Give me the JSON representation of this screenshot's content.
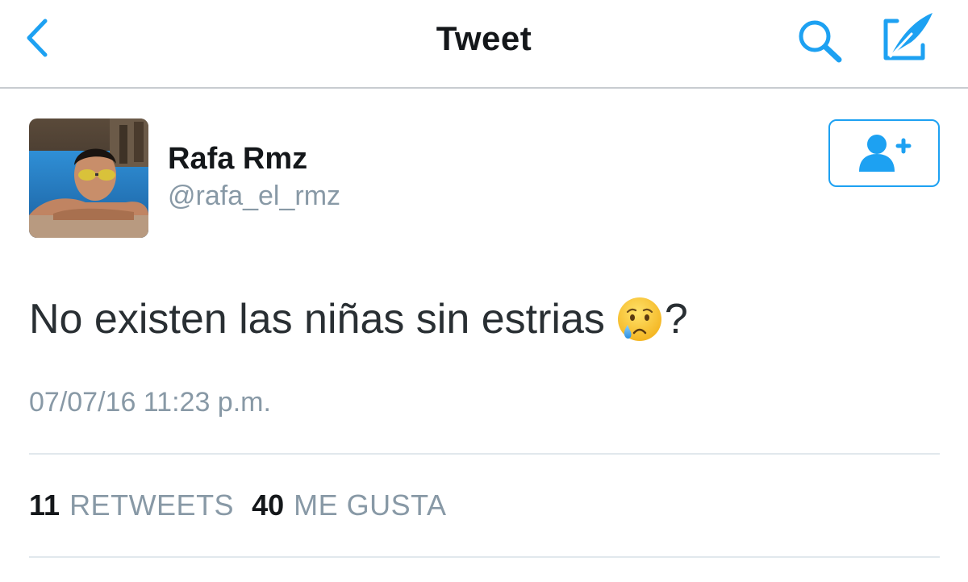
{
  "header": {
    "title": "Tweet",
    "back_icon": "chevron-left-icon",
    "search_icon": "search-icon",
    "compose_icon": "compose-tweet-icon",
    "accent_color": "#1da1f2"
  },
  "author": {
    "name": "Rafa Rmz",
    "handle": "@rafa_el_rmz",
    "avatar": "avatar-photo",
    "follow_icon": "add-user-icon"
  },
  "tweet": {
    "text": "No existen las niñas sin estrias",
    "emoji": "crying-face-emoji",
    "text_suffix": "?",
    "timestamp": "07/07/16 11:23 p.m."
  },
  "stats": {
    "retweets_count": "11",
    "retweets_label": "RETWEETS",
    "likes_count": "40",
    "likes_label": "ME GUSTA"
  }
}
